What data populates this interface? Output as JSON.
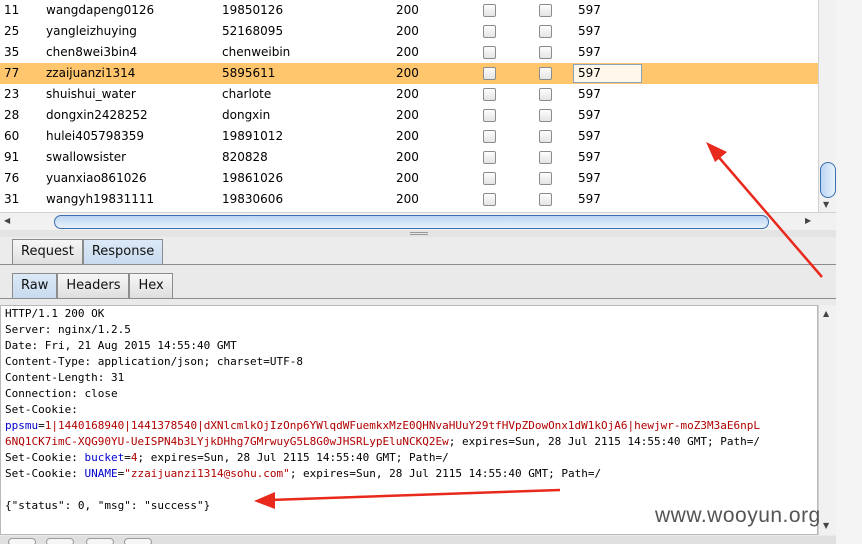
{
  "table": {
    "rows": [
      {
        "id": "11",
        "username": "wangdapeng0126",
        "password": "19850126",
        "status": "200",
        "length": "597",
        "selected": false
      },
      {
        "id": "25",
        "username": "yangleizhuying",
        "password": "52168095",
        "status": "200",
        "length": "597",
        "selected": false
      },
      {
        "id": "35",
        "username": "chen8wei3bin4",
        "password": "chenweibin",
        "status": "200",
        "length": "597",
        "selected": false
      },
      {
        "id": "77",
        "username": "zzaijuanzi1314",
        "password": "5895611",
        "status": "200",
        "length": "597",
        "selected": true
      },
      {
        "id": "23",
        "username": "shuishui_water",
        "password": "charlote",
        "status": "200",
        "length": "597",
        "selected": false
      },
      {
        "id": "28",
        "username": "dongxin2428252",
        "password": "dongxin",
        "status": "200",
        "length": "597",
        "selected": false
      },
      {
        "id": "60",
        "username": "hulei405798359",
        "password": "19891012",
        "status": "200",
        "length": "597",
        "selected": false
      },
      {
        "id": "91",
        "username": "swallowsister",
        "password": "820828",
        "status": "200",
        "length": "597",
        "selected": false
      },
      {
        "id": "76",
        "username": "yuanxiao861026",
        "password": "19861026",
        "status": "200",
        "length": "597",
        "selected": false
      },
      {
        "id": "31",
        "username": "wangyh19831111",
        "password": "19830606",
        "status": "200",
        "length": "597",
        "selected": false
      }
    ]
  },
  "tabs": {
    "main": [
      {
        "label": "Request",
        "active": false
      },
      {
        "label": "Response",
        "active": true
      }
    ],
    "sub": [
      {
        "label": "Raw",
        "active": true
      },
      {
        "label": "Headers",
        "active": false
      },
      {
        "label": "Hex",
        "active": false
      }
    ]
  },
  "response": {
    "status_line": "HTTP/1.1 200 OK",
    "server": "Server: nginx/1.2.5",
    "date": "Date: Fri, 21 Aug 2015 14:55:40 GMT",
    "content_type": "Content-Type: application/json; charset=UTF-8",
    "content_length": "Content-Length: 31",
    "connection": "Connection: close",
    "set_cookie_label": "Set-Cookie:",
    "cookie1_key": "ppsmu",
    "cookie1_value_a": "1|1440168940|1441378540|dXNlcmlkOjIzOnp6YWlqdWFuemkxMzE0QHNvaHUuY29tfHVpZDowOnx1dW1kOjA6|hewjwr-moZ3M3aE6npL",
    "cookie1_value_b": "6NQ1CK7imC-XQG90YU-UeISPN4b3LYjkDHhg7GMrwuyG5L8G0wJHSRLypEluNCKQ2Ew",
    "cookie1_rest": "; expires=Sun, 28 Jul 2115 14:55:40 GMT; Path=/",
    "cookie2_prefix": "Set-Cookie: ",
    "cookie2_key": "bucket",
    "cookie2_value": "4",
    "cookie2_rest": "; expires=Sun, 28 Jul 2115 14:55:40 GMT; Path=/",
    "cookie3_prefix": "Set-Cookie: ",
    "cookie3_key": "UNAME",
    "cookie3_value": "\"zzaijuanzi1314@sohu.com\"",
    "cookie3_rest": "; expires=Sun, 28 Jul 2115 14:55:40 GMT; Path=/",
    "body": "{\"status\": 0, \"msg\": \"success\"}"
  },
  "watermark": "www.wooyun.org",
  "colors": {
    "selected_row": "#ffc66d",
    "annotation_arrow": "#e8291c"
  },
  "icons": {
    "scroll_up": "triangle-up",
    "scroll_down": "triangle-down",
    "scroll_left": "triangle-left",
    "scroll_right": "triangle-right"
  }
}
